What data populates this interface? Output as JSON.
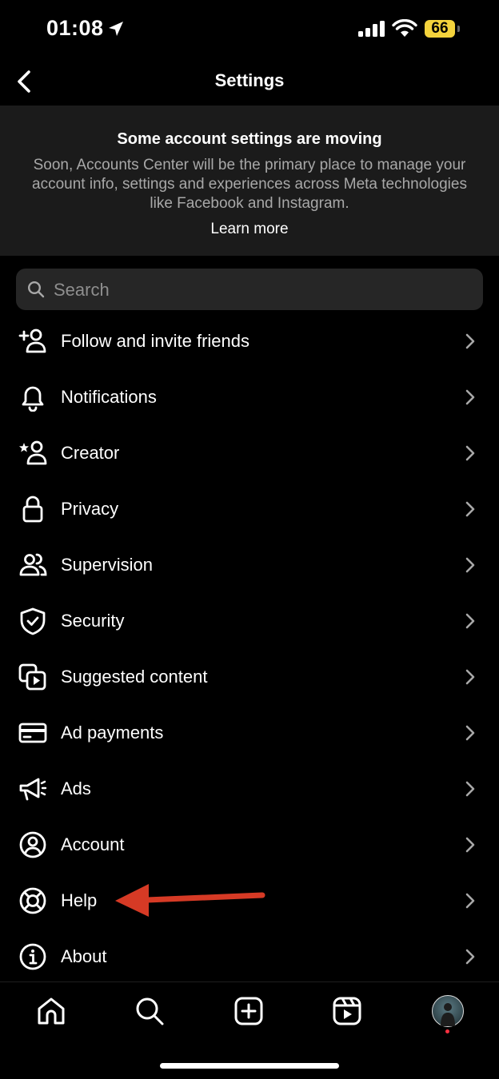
{
  "status_bar": {
    "time": "01:08",
    "battery": "66",
    "battery_color": "#f4d33c"
  },
  "header": {
    "title": "Settings"
  },
  "banner": {
    "title": "Some account settings are moving",
    "description": "Soon, Accounts Center will be the primary place to manage your account info, settings and experiences across Meta technologies like Facebook and Instagram.",
    "link": "Learn more"
  },
  "search": {
    "placeholder": "Search"
  },
  "menu": {
    "items": [
      {
        "label": "Follow and invite friends",
        "icon": "add-person-icon"
      },
      {
        "label": "Notifications",
        "icon": "bell-icon"
      },
      {
        "label": "Creator",
        "icon": "creator-star-person-icon"
      },
      {
        "label": "Privacy",
        "icon": "lock-icon"
      },
      {
        "label": "Supervision",
        "icon": "people-icon"
      },
      {
        "label": "Security",
        "icon": "shield-check-icon"
      },
      {
        "label": "Suggested content",
        "icon": "suggested-content-icon"
      },
      {
        "label": "Ad payments",
        "icon": "credit-card-icon"
      },
      {
        "label": "Ads",
        "icon": "megaphone-icon"
      },
      {
        "label": "Account",
        "icon": "account-circle-icon"
      },
      {
        "label": "Help",
        "icon": "lifebuoy-icon"
      },
      {
        "label": "About",
        "icon": "info-icon"
      }
    ]
  },
  "annotation": {
    "arrow_color": "#d63a25"
  },
  "tab_bar": {
    "tabs": [
      "home-icon",
      "search-icon",
      "create-post-icon",
      "reels-icon",
      "profile-avatar"
    ],
    "notification_dot_color": "#ff3040"
  }
}
